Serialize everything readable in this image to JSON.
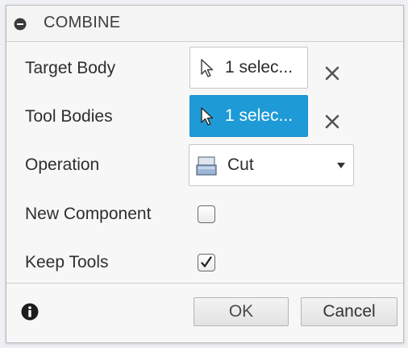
{
  "dialog": {
    "title": "COMBINE",
    "collapse_icon": "minus-circle-icon"
  },
  "fields": {
    "target_body": {
      "label": "Target Body",
      "value": "1 selec...",
      "icon": "cursor-arrow-icon",
      "clear_icon": "close-x-icon"
    },
    "tool_bodies": {
      "label": "Tool Bodies",
      "value": "1 selec...",
      "icon": "cursor-arrow-icon",
      "clear_icon": "close-x-icon",
      "active": true,
      "active_color": "#1e9bd7"
    },
    "operation": {
      "label": "Operation",
      "value": "Cut",
      "icon": "cut-operation-icon"
    },
    "new_component": {
      "label": "New Component",
      "checked": false
    },
    "keep_tools": {
      "label": "Keep Tools",
      "checked": true
    }
  },
  "footer": {
    "info_icon": "info-icon",
    "ok_label": "OK",
    "cancel_label": "Cancel"
  }
}
